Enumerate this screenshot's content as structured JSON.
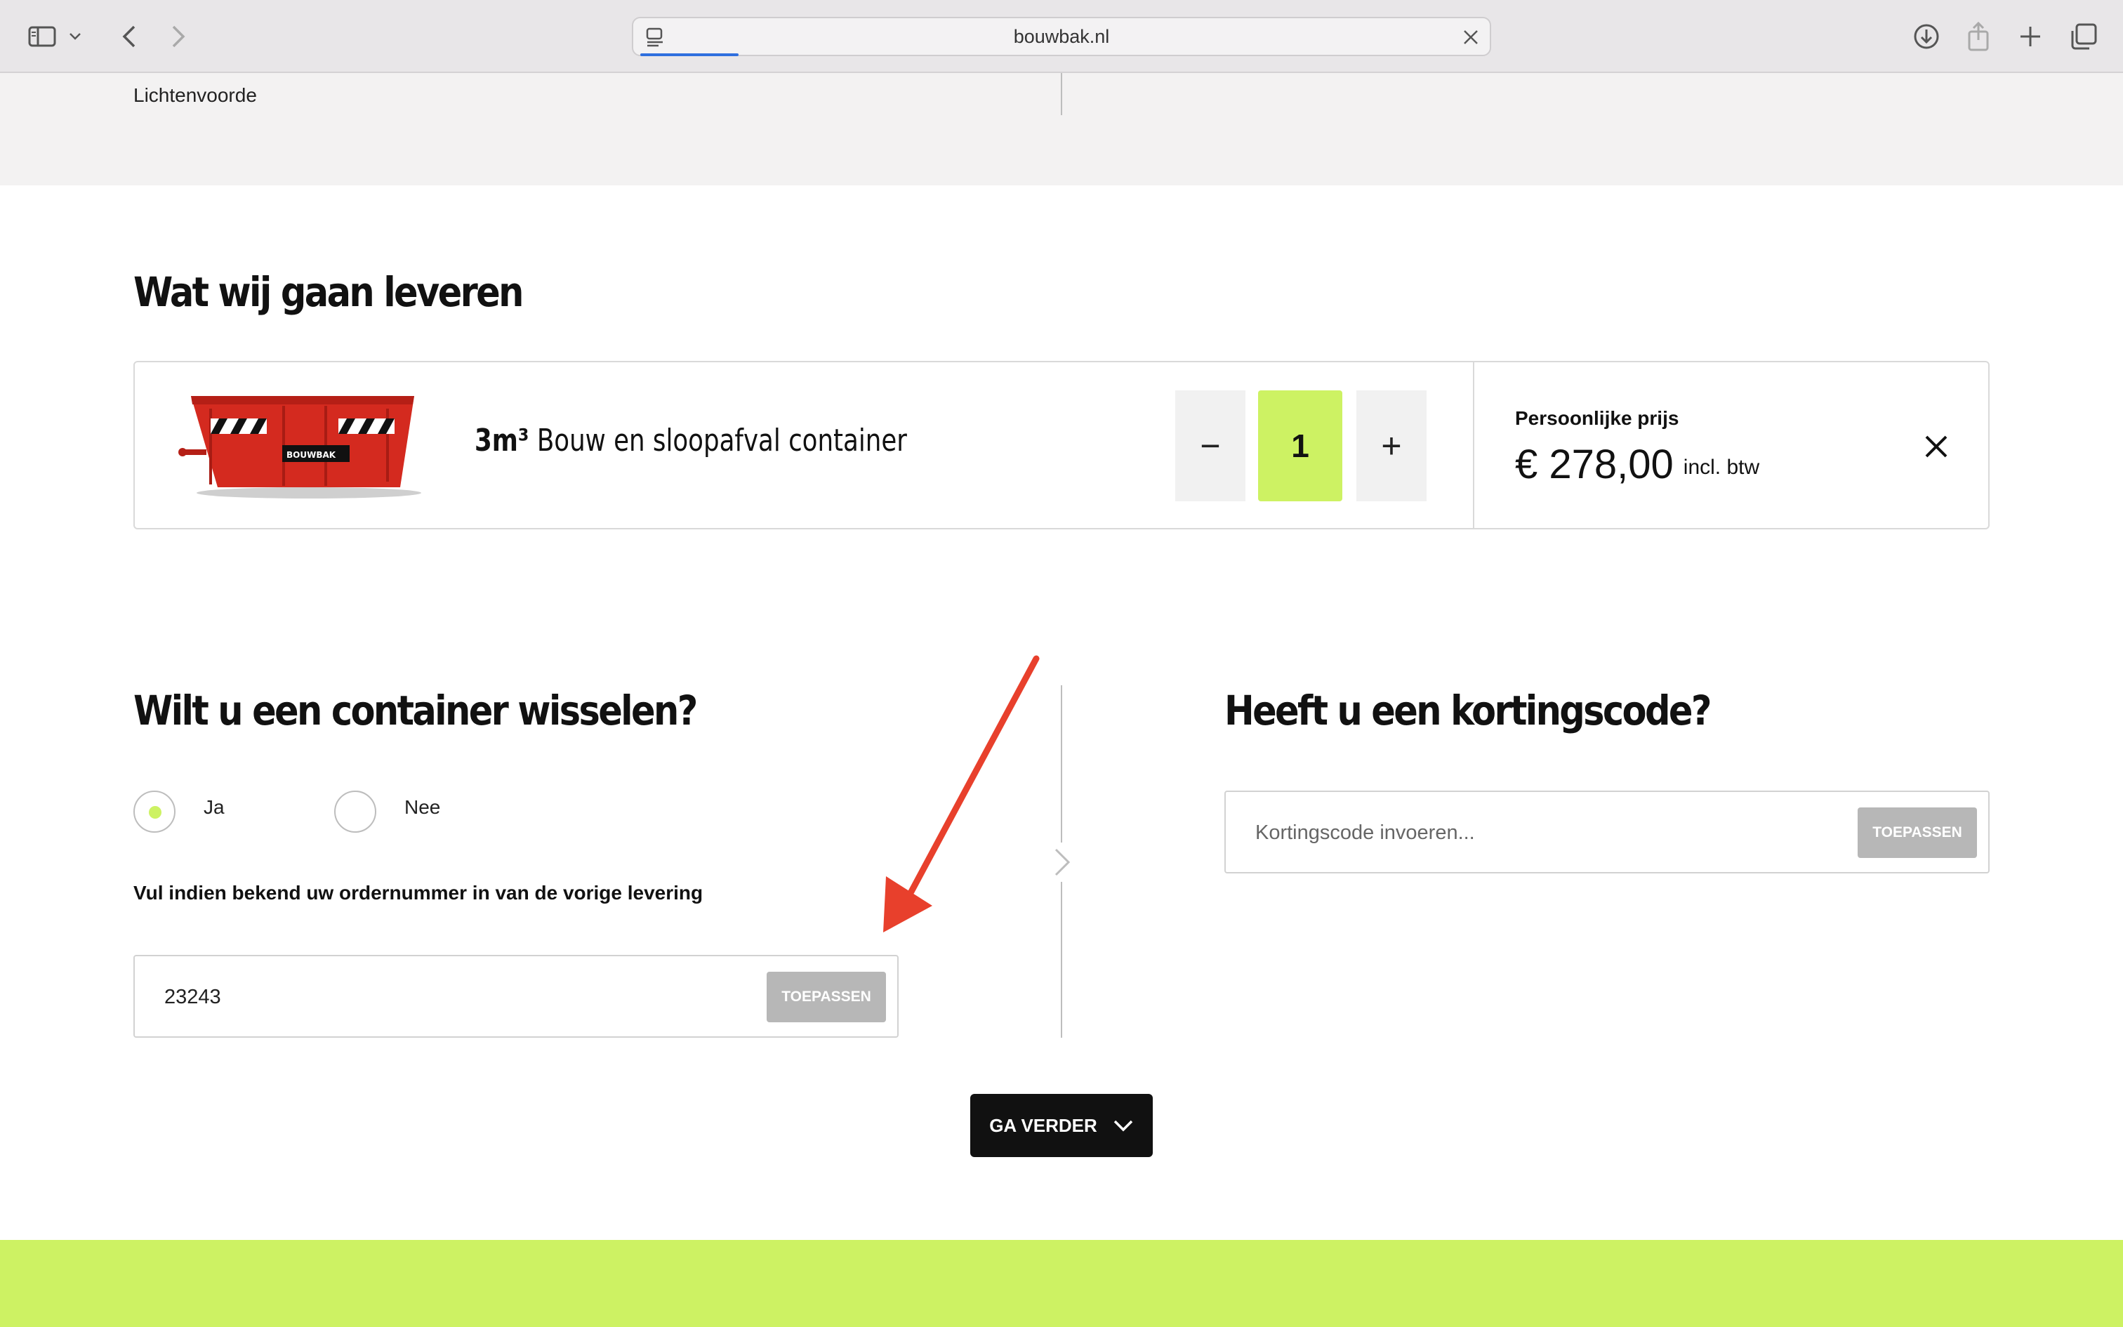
{
  "browser": {
    "url": "bouwbak.nl"
  },
  "location": {
    "city": "Lichtenvoorde"
  },
  "delivery": {
    "heading": "Wat wij gaan leveren",
    "product": {
      "volume": "3m³",
      "name": " Bouw en sloopafval container",
      "brand": "BOUWBAK",
      "quantity": "1",
      "minus": "−",
      "plus": "+",
      "price_label": "Persoonlijke prijs",
      "price": "€ 278,00",
      "vat_note": "incl. btw"
    }
  },
  "swap": {
    "heading": "Wilt u een container wisselen?",
    "options": [
      {
        "label": "Ja",
        "selected": true
      },
      {
        "label": "Nee",
        "selected": false
      }
    ],
    "hint": "Vul indien bekend uw ordernummer in van de vorige levering",
    "order_value": "23243",
    "apply_label": "TOEPASSEN"
  },
  "discount": {
    "heading": "Heeft u een kortingscode?",
    "placeholder": "Kortingscode invoeren...",
    "apply_label": "TOEPASSEN"
  },
  "cta": {
    "label": "GA VERDER"
  },
  "colors": {
    "accent": "#cdf263",
    "annotation_arrow": "#e8402c",
    "container_red": "#d42a1f"
  }
}
